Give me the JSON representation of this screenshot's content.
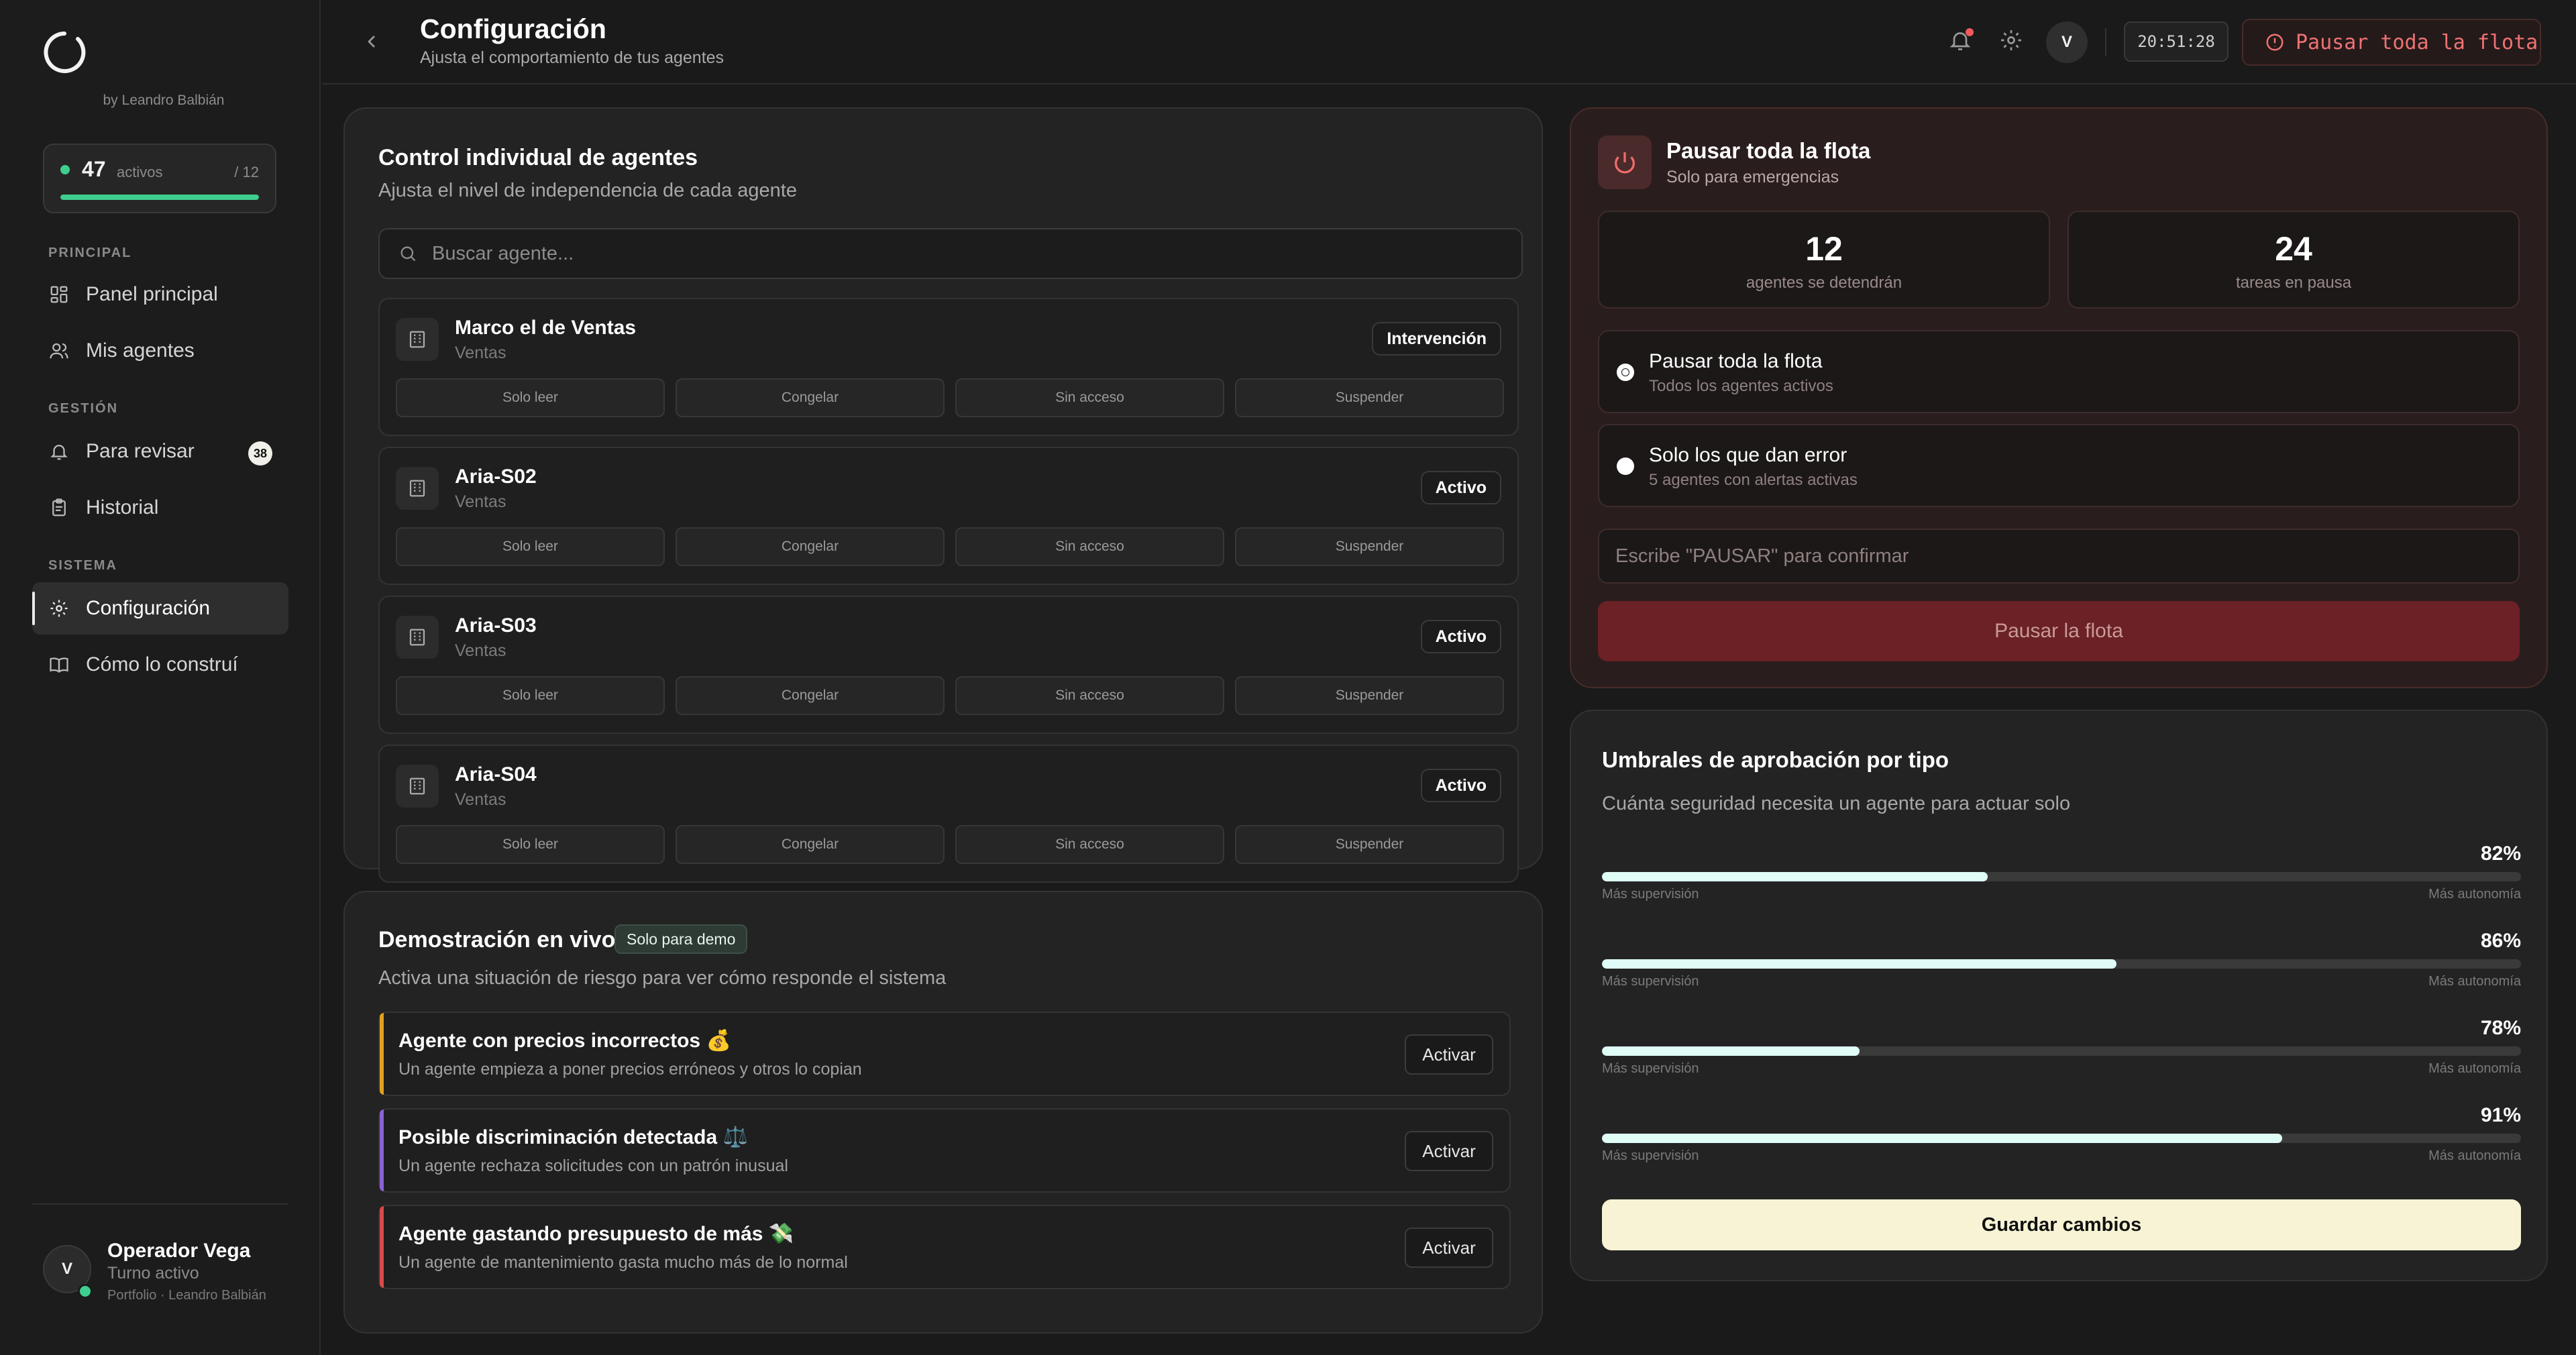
{
  "sidebar": {
    "byline": "by Leandro Balbián",
    "active": {
      "count": "47",
      "label": "activos",
      "total": "/ 12",
      "progress": 1.0
    },
    "sections": [
      {
        "label": "PRINCIPAL",
        "items": [
          {
            "label": "Panel principal",
            "icon": "dashboard-icon"
          },
          {
            "label": "Mis agentes",
            "icon": "users-icon"
          }
        ]
      },
      {
        "label": "GESTIÓN",
        "items": [
          {
            "label": "Para revisar",
            "icon": "bell-icon",
            "badge": "38"
          },
          {
            "label": "Historial",
            "icon": "clipboard-icon"
          }
        ]
      },
      {
        "label": "SISTEMA",
        "items": [
          {
            "label": "Configuración",
            "icon": "gear-icon",
            "active": true
          },
          {
            "label": "Cómo lo construí",
            "icon": "book-icon"
          }
        ]
      }
    ],
    "user": {
      "initial": "V",
      "name": "Operador Vega",
      "status": "Turno activo",
      "footer": "Portfolio · Leandro Balbián"
    }
  },
  "header": {
    "title": "Configuración",
    "subtitle": "Ajusta el comportamiento de tus agentes",
    "avatar": "V",
    "clock": "20:51:28",
    "pause_all_label": "Pausar toda la flota"
  },
  "agents_panel": {
    "title": "Control individual de agentes",
    "subtitle": "Ajusta el nivel de independencia de cada agente",
    "search_placeholder": "Buscar agente...",
    "actions": [
      "Solo leer",
      "Congelar",
      "Sin acceso",
      "Suspender"
    ],
    "agents": [
      {
        "name": "Marco el de Ventas",
        "dept": "Ventas",
        "status": "Intervención"
      },
      {
        "name": "Aria-S02",
        "dept": "Ventas",
        "status": "Activo"
      },
      {
        "name": "Aria-S03",
        "dept": "Ventas",
        "status": "Activo"
      },
      {
        "name": "Aria-S04",
        "dept": "Ventas",
        "status": "Activo"
      }
    ]
  },
  "demo_panel": {
    "title": "Demostración en vivo",
    "badge": "Solo para demo",
    "subtitle": "Activa una situación de riesgo para ver cómo responde el sistema",
    "scenarios": [
      {
        "title": "Agente con precios incorrectos 💰",
        "desc": "Un agente empieza a poner precios erróneos y otros lo copian",
        "button": "Activar",
        "color": "#e0a020"
      },
      {
        "title": "Posible discriminación detectada ⚖️",
        "desc": "Un agente rechaza solicitudes con un patrón inusual",
        "button": "Activar",
        "color": "#8a63d2"
      },
      {
        "title": "Agente gastando presupuesto de más 💸",
        "desc": "Un agente de mantenimiento gasta mucho más de lo normal",
        "button": "Activar",
        "color": "#d84a4a"
      }
    ]
  },
  "emergency_panel": {
    "title": "Pausar toda la flota",
    "subtitle": "Solo para emergencias",
    "stats": [
      {
        "value": "12",
        "label": "agentes se detendrán"
      },
      {
        "value": "24",
        "label": "tareas en pausa"
      }
    ],
    "options": [
      {
        "title": "Pausar toda la flota",
        "sub": "Todos los agentes activos",
        "selected": true
      },
      {
        "title": "Solo los que dan error",
        "sub": "5 agentes con alertas activas",
        "selected": false
      }
    ],
    "confirm_placeholder": "Escribe \"PAUSAR\" para confirmar",
    "button": "Pausar la flota"
  },
  "thresholds_panel": {
    "title": "Umbrales de aprobación por tipo",
    "subtitle": "Cuánta seguridad necesita un agente para actuar solo",
    "left_label": "Más supervisión",
    "right_label": "Más autonomía",
    "rows": [
      {
        "pct": "82%",
        "fill": 0.42
      },
      {
        "pct": "86%",
        "fill": 0.56
      },
      {
        "pct": "78%",
        "fill": 0.28
      },
      {
        "pct": "91%",
        "fill": 0.74
      }
    ],
    "save": "Guardar cambios"
  }
}
